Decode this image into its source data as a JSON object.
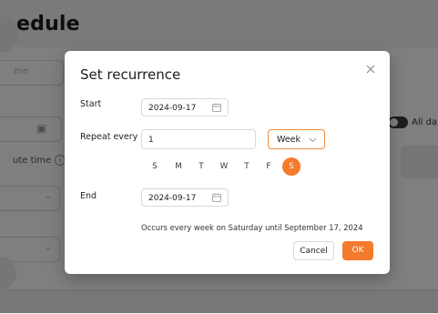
{
  "background": {
    "page_title": "edule",
    "input_placeholder": "me",
    "time_label": "ute time",
    "all_day_label": "All da"
  },
  "modal": {
    "title": "Set recurrence",
    "start": {
      "label": "Start",
      "value": "2024-09-17"
    },
    "repeat": {
      "label": "Repeat every",
      "interval": "1",
      "unit": "Week",
      "days": [
        {
          "label": "S",
          "selected": false
        },
        {
          "label": "M",
          "selected": false
        },
        {
          "label": "T",
          "selected": false
        },
        {
          "label": "W",
          "selected": false
        },
        {
          "label": "T",
          "selected": false
        },
        {
          "label": "F",
          "selected": false
        },
        {
          "label": "S",
          "selected": true
        }
      ]
    },
    "end": {
      "label": "End",
      "value": "2024-09-17"
    },
    "summary": "Occurs every week on Saturday until September 17, 2024",
    "cancel_label": "Cancel",
    "ok_label": "OK"
  },
  "colors": {
    "accent": "#f47a2c",
    "overlay": "rgba(0,0,0,0.5)"
  }
}
